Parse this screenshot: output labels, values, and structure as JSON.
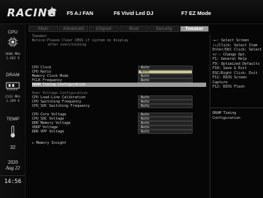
{
  "header": {
    "logo_text": "RACING",
    "hotkeys": [
      "F5 A.I FAN",
      "F6 Vivid Led DJ",
      "F7 EZ Mode"
    ]
  },
  "rail": {
    "cpu": {
      "label": "CPU",
      "freq": "3600 MHz",
      "volt": "1.462 V",
      "icon": "cpu-chip-icon"
    },
    "dram": {
      "label": "DRAM",
      "freq": "2133 MHz",
      "volt": "1.199 V",
      "icon": "dram-module-icon"
    },
    "temp": {
      "label": "TEMP",
      "value": "32",
      "icon": "thermometer-icon"
    },
    "clock": {
      "year": "2020",
      "date": "Aug 22",
      "time": "14:56"
    }
  },
  "tabs": [
    "Main",
    "Advanced",
    "Chipset",
    "Boot",
    "Security",
    "Tweaker"
  ],
  "active_tab": "Tweaker",
  "main": {
    "section_title": "Tweaker",
    "notice_line1": "Notice:Please Clear CMOS if system no display",
    "notice_line2": "after overclocking",
    "items": [
      {
        "label": "CPU Clock",
        "value": "Auto"
      },
      {
        "label": "CPU Ratio",
        "value": "Auto",
        "editing": true
      },
      {
        "label": "Memory Clock Mode",
        "value": "Auto"
      },
      {
        "label": "FCLK Frequency",
        "value": "Auto"
      },
      {
        "label": "DRAM Timing Configuration",
        "value": "",
        "selected": true
      },
      {
        "label": "Over Voltage Configuration",
        "value": "",
        "heading": true
      },
      {
        "label": "CPU Load-Line Calibration",
        "value": "Auto"
      },
      {
        "label": "CPU Switching Frequency",
        "value": "Auto"
      },
      {
        "label": "CPU_SOC Switching Frequency",
        "value": "Auto"
      },
      {
        "label": "CPU Core Voltage",
        "value": "Auto"
      },
      {
        "label": "CPU_SOC Voltage",
        "value": "Auto"
      },
      {
        "label": "DDR Memory Voltage",
        "value": "Auto"
      },
      {
        "label": "VDDP Voltage",
        "value": "Auto"
      },
      {
        "label": "DDR VPP Voltage",
        "value": "Auto"
      },
      {
        "label": "▸ Memory Insight",
        "value": ""
      }
    ]
  },
  "help": {
    "keys": "→←: Select Screen\n↑↓/Click: Select Item\nEnter/Dbl Click: Select\n+/-: Change Opt.\nF1: General Help\nF9: Optimized Defaults\nF10: Save & Exit\nESC/Right Click: Exit\nF11: BIOS Screen\nCapture\nF12: BIOS Flash",
    "description": "DRAM Timing\nConfiguration"
  }
}
